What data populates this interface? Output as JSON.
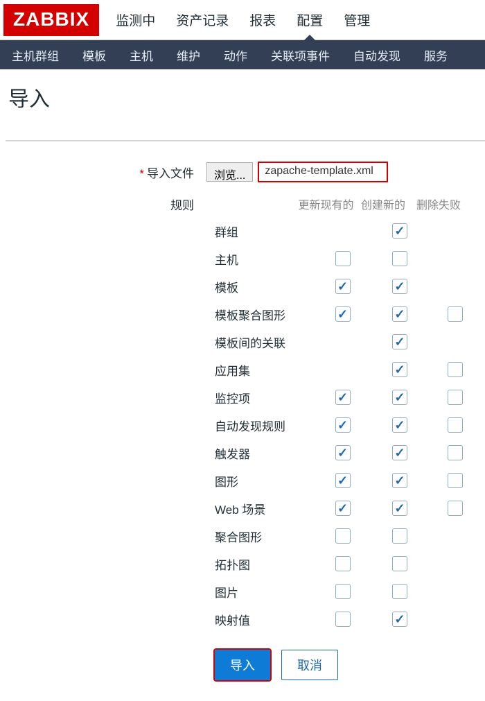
{
  "logo": "ZABBIX",
  "topnav": [
    {
      "label": "监测中",
      "active": false
    },
    {
      "label": "资产记录",
      "active": false
    },
    {
      "label": "报表",
      "active": false
    },
    {
      "label": "配置",
      "active": true
    },
    {
      "label": "管理",
      "active": false
    }
  ],
  "subnav": [
    "主机群组",
    "模板",
    "主机",
    "维护",
    "动作",
    "关联项事件",
    "自动发现",
    "服务"
  ],
  "page_title": "导入",
  "labels": {
    "import_file": "导入文件",
    "rules": "规则",
    "browse": "浏览..."
  },
  "file_name": "zapache-template.xml",
  "rule_headers": {
    "update_existing": "更新现有的",
    "create_new": "创建新的",
    "delete_missing": "删除失败"
  },
  "rules": [
    {
      "name": "群组",
      "c1": null,
      "c2": true,
      "c3": null
    },
    {
      "name": "主机",
      "c1": false,
      "c2": false,
      "c3": null
    },
    {
      "name": "模板",
      "c1": true,
      "c2": true,
      "c3": null
    },
    {
      "name": "模板聚合图形",
      "c1": true,
      "c2": true,
      "c3": false
    },
    {
      "name": "模板间的关联",
      "c1": null,
      "c2": true,
      "c3": null
    },
    {
      "name": "应用集",
      "c1": null,
      "c2": true,
      "c3": false
    },
    {
      "name": "监控项",
      "c1": true,
      "c2": true,
      "c3": false
    },
    {
      "name": "自动发现规则",
      "c1": true,
      "c2": true,
      "c3": false
    },
    {
      "name": "触发器",
      "c1": true,
      "c2": true,
      "c3": false
    },
    {
      "name": "图形",
      "c1": true,
      "c2": true,
      "c3": false
    },
    {
      "name": "Web 场景",
      "c1": true,
      "c2": true,
      "c3": false
    },
    {
      "name": "聚合图形",
      "c1": false,
      "c2": false,
      "c3": null
    },
    {
      "name": "拓扑图",
      "c1": false,
      "c2": false,
      "c3": null
    },
    {
      "name": "图片",
      "c1": false,
      "c2": false,
      "c3": null
    },
    {
      "name": "映射值",
      "c1": false,
      "c2": true,
      "c3": null
    }
  ],
  "buttons": {
    "import": "导入",
    "cancel": "取消"
  }
}
